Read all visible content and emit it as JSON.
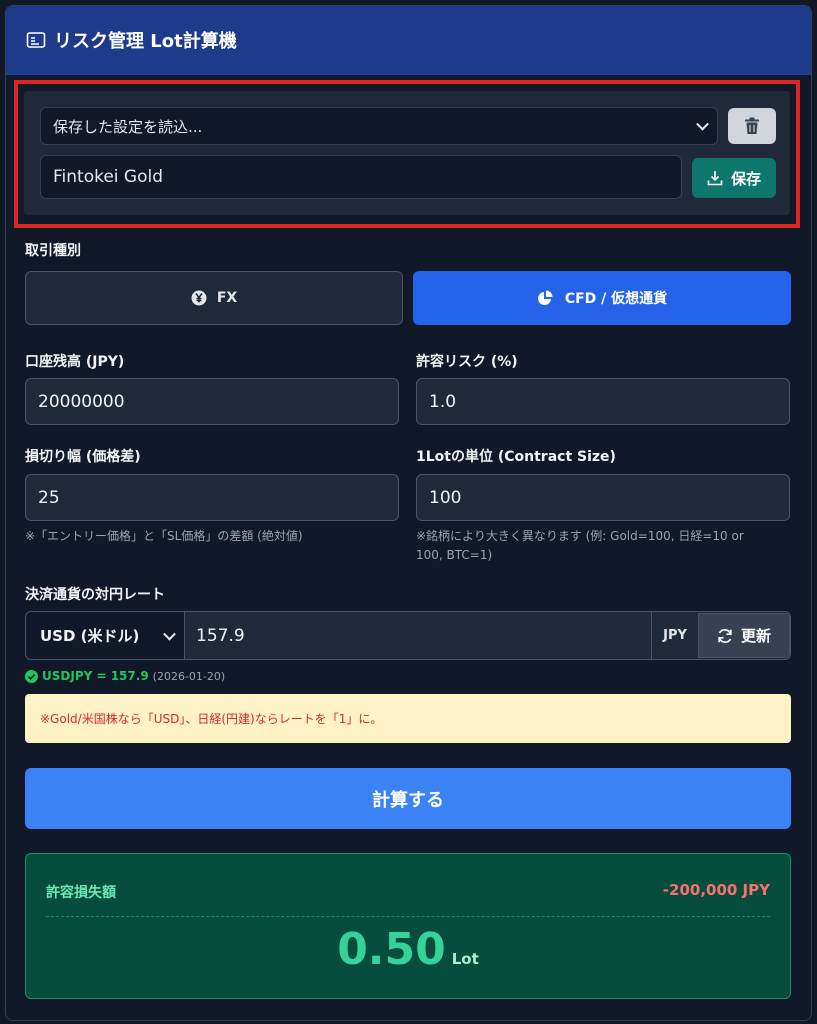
{
  "header": {
    "title": "リスク管理 Lot計算機"
  },
  "settings": {
    "load_select": "保存した設定を読込...",
    "name_value": "Fintokei Gold",
    "save_label": "保存"
  },
  "trade_type": {
    "label": "取引種別",
    "fx_label": "FX",
    "cfd_label": "CFD / 仮想通貨"
  },
  "balance": {
    "label": "口座残高 (JPY)",
    "value": "20000000"
  },
  "risk": {
    "label": "許容リスク (%)",
    "value": "1.0"
  },
  "stop": {
    "label": "損切り幅 (価格差)",
    "value": "25",
    "note": "※「エントリー価格」と「SL価格」の差額 (絶対値)"
  },
  "contract": {
    "label": "1Lotの単位 (Contract Size)",
    "value": "100",
    "note1": "※銘柄により大きく異なります (例: Gold=100, 日経=10 or",
    "note2": "100, BTC=1)"
  },
  "rate": {
    "label": "決済通貨の対円レート",
    "currency": "USD (米ドル)",
    "value": "157.9",
    "unit": "JPY",
    "refresh_label": "更新",
    "status_pair": "USDJPY = 157.9",
    "status_date": "(2026-01-20)"
  },
  "warning": "※Gold/米国株なら「USD」、日経(円建)ならレートを「1」に。",
  "calculate_label": "計算する",
  "result": {
    "loss_label": "許容損失額",
    "loss_value": "-200,000 JPY",
    "lot_value": "0.50",
    "lot_unit": "Lot"
  },
  "colors": {
    "header_bg": "#1e3a8a",
    "primary_blue": "#2563eb",
    "save_green": "#0f766e",
    "result_bg": "#064e3b",
    "result_green": "#34d399",
    "loss_red": "#f87171"
  }
}
